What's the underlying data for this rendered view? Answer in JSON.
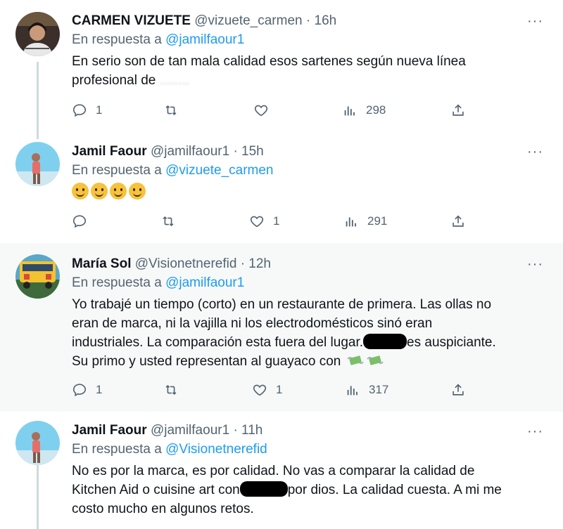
{
  "tweets": [
    {
      "name": "CARMEN VIZUETE",
      "handle": "@vizuete_carmen",
      "time": "· 16h",
      "reply_prefix": "En respuesta a",
      "reply_to": "@jamilfaour1",
      "text_line1": "En serio son de tan mala calidad esos sartenes según nueva línea",
      "text_line2": "profesional de",
      "text_line2_blur": "........",
      "replies": "1",
      "retweets": "",
      "likes": "",
      "views": "298"
    },
    {
      "name": "Jamil Faour",
      "handle": "@jamilfaour1",
      "time": "· 15h",
      "reply_prefix": "En respuesta a",
      "reply_to": "@vizuete_carmen",
      "replies": "",
      "retweets": "",
      "likes": "1",
      "views": "291"
    },
    {
      "name": "María Sol",
      "handle": "@Visionetnerefid",
      "time": "· 12h",
      "reply_prefix": "En respuesta a",
      "reply_to": "@jamilfaour1",
      "text_line1": "Yo trabajé un tiempo (corto) en un restaurante de primera.  Las ollas no",
      "text_line2": "eran de marca, ni la vajilla ni los electrodomésticos sinó eran",
      "text_line3a": "industriales.  La comparación esta fuera del lugar.",
      "text_line3b": "es auspiciante.",
      "text_line4": "Su primo y usted representan al guayaco con",
      "replies": "1",
      "retweets": "",
      "likes": "1",
      "views": "317"
    },
    {
      "name": "Jamil Faour",
      "handle": "@jamilfaour1",
      "time": "· 11h",
      "reply_prefix": "En respuesta a",
      "reply_to": "@Visionetnerefid",
      "text_line1": "No es por la marca, es por calidad. No vas a comparar la calidad de",
      "text_line2a": "Kitchen Aid o cuisine art con",
      "text_line2b": "por dios. La calidad cuesta. A mi me",
      "text_line3": "costo mucho en algunos retos."
    }
  ],
  "more_glyph": "···",
  "colors": {
    "link": "#1d9bf0",
    "muted": "#536471",
    "highlight_bg": "#f7f9f9"
  }
}
